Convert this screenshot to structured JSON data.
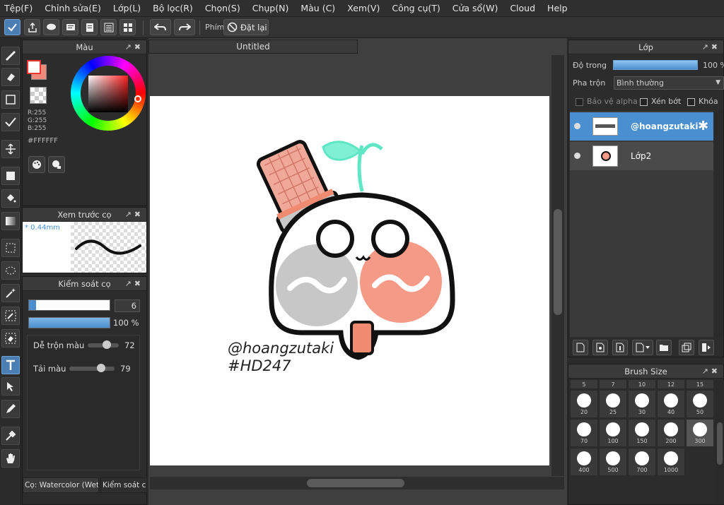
{
  "menu": [
    "Tệp(F)",
    "Chỉnh sửa(E)",
    "Lớp(L)",
    "Bộ lọc(R)",
    "Chọn(S)",
    "Chụp(N)",
    "Màu (C)",
    "Xem(V)",
    "Công cụ(T)",
    "Cửa sổ(W)",
    "Cloud",
    "Help"
  ],
  "toolbar": {
    "shortcut_label": "Phím",
    "reset_label": "Đặt lại"
  },
  "color_panel": {
    "title": "Màu",
    "r": "R:255",
    "g": "G:255",
    "b": "B:255",
    "hex": "#FFFFFF",
    "primary_color": "#ffffff",
    "secondary_color": "#f08a7a"
  },
  "brush_preview": {
    "title": "Xem trước cọ",
    "size": "* 0.44mm"
  },
  "brush_control": {
    "title": "Kiểm soát cọ",
    "size_value": "6",
    "opacity_value": "100 %",
    "opacity_fraction": 1.0,
    "mix_label": "Dễ trộn màu",
    "mix_value": "72",
    "load_label": "Tải màu",
    "load_value": "79",
    "tab1": "Cọ: Watercolor (Wet)",
    "tab2": "Kiểm soát cọ"
  },
  "document": {
    "tab_title": "Untitled",
    "watermark_line1": "@hoangzutaki",
    "watermark_line2": "#HD247"
  },
  "layers": {
    "title": "Lớp",
    "opacity_label": "Độ trong",
    "opacity_value": "100 %",
    "blend_label": "Pha trộn",
    "blend_value": "Bình thường",
    "protect_alpha": "Bảo vệ alpha",
    "clipping": "Xén bớt",
    "lock": "Khóa",
    "items": [
      {
        "name": "@hoangzutaki",
        "selected": true
      },
      {
        "name": "Lớp2",
        "selected": false
      }
    ]
  },
  "brush_size": {
    "title": "Brush Size",
    "top_labels": [
      "5",
      "7",
      "10",
      "12",
      "15"
    ],
    "sizes": [
      "20",
      "25",
      "30",
      "40",
      "50",
      "70",
      "100",
      "150",
      "200",
      "300",
      "400",
      "500",
      "700",
      "1000"
    ]
  },
  "colors": {
    "accent": "#4b8fcf",
    "selection": "#4a90d0"
  }
}
